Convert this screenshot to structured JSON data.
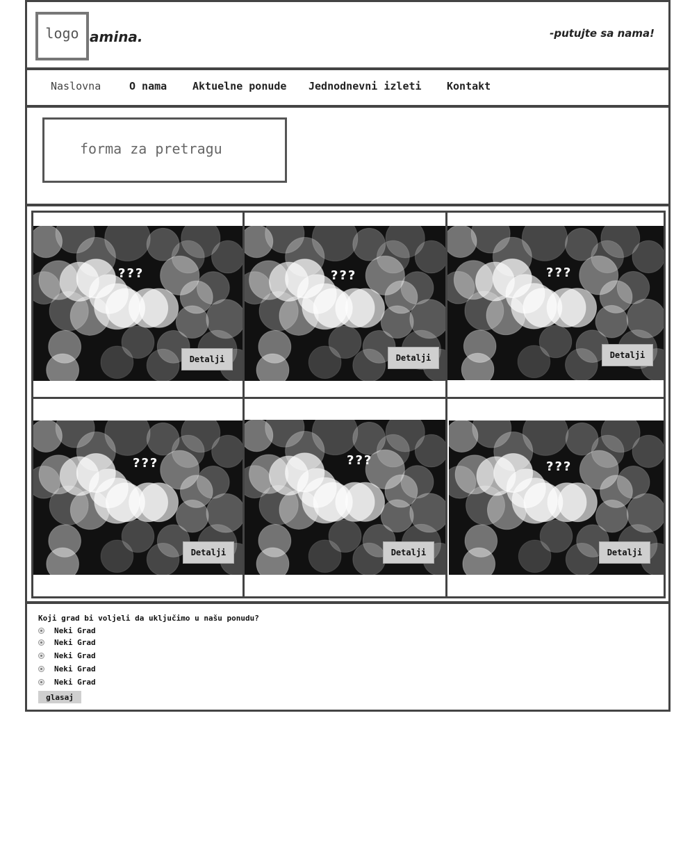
{
  "header": {
    "logo_label": "logo",
    "brand": "amina.",
    "tagline": "-putujte sa nama!"
  },
  "nav": {
    "items": [
      {
        "label": "Naslovna",
        "active": true
      },
      {
        "label": "O nama",
        "active": false
      },
      {
        "label": "Aktuelne ponude",
        "active": false
      },
      {
        "label": "Jednodnevni izleti",
        "active": false
      },
      {
        "label": "Kontakt",
        "active": false
      }
    ]
  },
  "search": {
    "label": "forma za pretragu"
  },
  "offers": [
    {
      "title": "???",
      "button": "Detalji"
    },
    {
      "title": "???",
      "button": "Detalji"
    },
    {
      "title": "???",
      "button": "Detalji"
    },
    {
      "title": "???",
      "button": "Detalji"
    },
    {
      "title": "???",
      "button": "Detalji"
    },
    {
      "title": "???",
      "button": "Detalji"
    }
  ],
  "poll": {
    "question": "Koji grad bi voljeli da uključimo u našu ponudu?",
    "options": [
      "Neki Grad",
      "Neki Grad",
      "Neki Grad",
      "Neki Grad",
      "Neki Grad"
    ],
    "vote_label": "glasaj"
  },
  "colors": {
    "border": "#444444",
    "button_bg": "#cfcfcf",
    "photo_bg": "#0b0b0b"
  }
}
